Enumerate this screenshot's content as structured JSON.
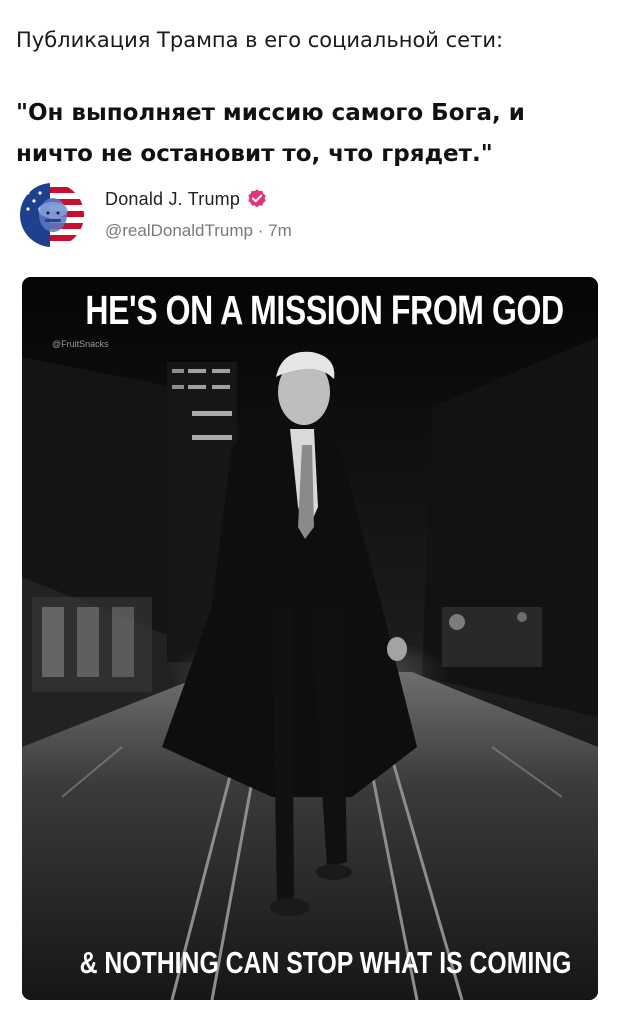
{
  "header": {
    "caption": "Публикация Трампа в его социальной сети:"
  },
  "quote": {
    "line1": "\"Он выполняет миссию самого Бога, и",
    "line2": "ничто не остановит то, что грядет.\""
  },
  "post": {
    "author_name": "Donald J. Trump",
    "handle": "@realDonaldTrump",
    "separator": "·",
    "time": "7m",
    "avatar_icon": "flag-portrait-avatar",
    "verified_icon": "verified-badge-icon",
    "verified_color": "#e8317a",
    "image": {
      "top_text": "HE'S ON A MISSION FROM GOD",
      "watermark": "@FruitSnacks",
      "bottom_text": "& NOTHING CAN STOP WHAT IS COMING"
    }
  }
}
